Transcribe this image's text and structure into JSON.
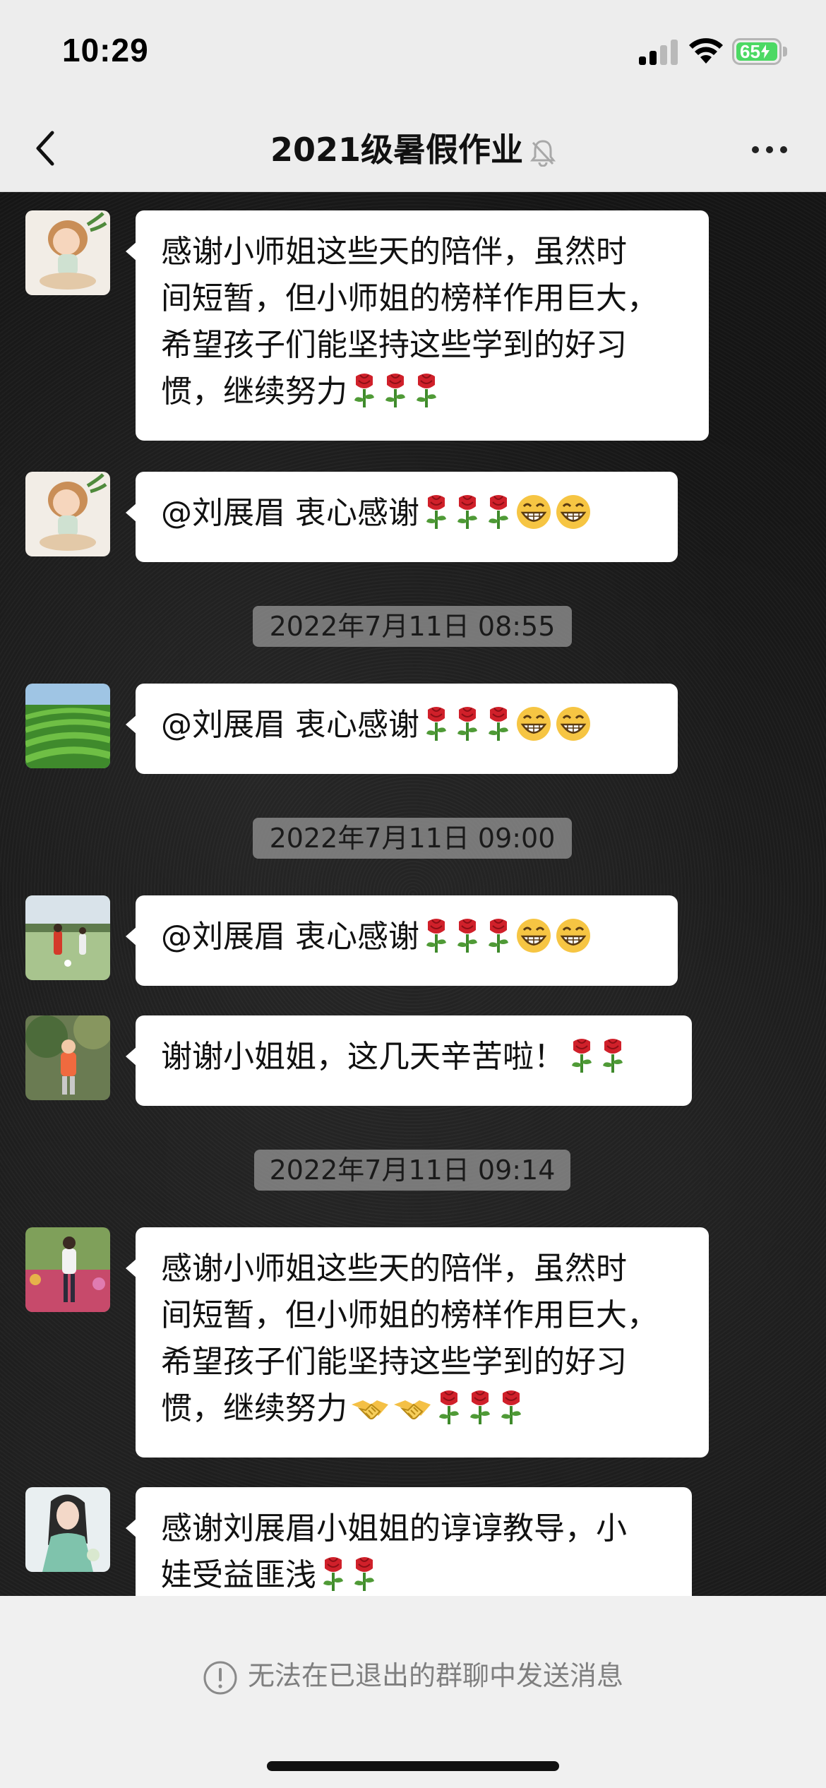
{
  "status_bar": {
    "time": "10:29",
    "battery_level": "65",
    "signal_bars": 4,
    "signal_bars_active": 2,
    "icons": [
      "signal-icon",
      "wifi-icon",
      "battery-charging-icon"
    ]
  },
  "nav": {
    "title": "2021级暑假作业",
    "muted_icon": "bell-muted-icon",
    "back_icon": "chevron-left-icon",
    "more_icon": "more-dots-icon"
  },
  "messages": [
    {
      "type": "message",
      "avatar": "avatar-meditating-girl",
      "lines": [
        "感谢小师姐这些天的陪伴，虽然时",
        "间短暂，但小师姐的榜样作用巨大，",
        "希望孩子们能坚持这些学到的好习",
        "惯，继续努力"
      ],
      "emoji": [
        "rose",
        "rose",
        "rose"
      ]
    },
    {
      "type": "message",
      "avatar": "avatar-meditating-girl",
      "lines": [
        "@刘展眉 衷心感谢"
      ],
      "emoji": [
        "rose",
        "rose",
        "rose",
        "grin",
        "grin"
      ]
    },
    {
      "type": "time",
      "text": "2022年7月11日 08:55"
    },
    {
      "type": "message",
      "avatar": "avatar-tea-field",
      "lines": [
        "@刘展眉 衷心感谢"
      ],
      "emoji": [
        "rose",
        "rose",
        "rose",
        "grin",
        "grin"
      ]
    },
    {
      "type": "time",
      "text": "2022年7月11日 09:00"
    },
    {
      "type": "message",
      "avatar": "avatar-soccer-kids",
      "lines": [
        "@刘展眉 衷心感谢"
      ],
      "emoji": [
        "rose",
        "rose",
        "rose",
        "grin",
        "grin"
      ]
    },
    {
      "type": "message",
      "avatar": "avatar-child-garden",
      "lines": [
        "谢谢小姐姐，这几天辛苦啦！"
      ],
      "emoji": [
        "rose",
        "rose"
      ]
    },
    {
      "type": "time",
      "text": "2022年7月11日 09:14"
    },
    {
      "type": "message",
      "avatar": "avatar-child-flowers",
      "lines": [
        "感谢小师姐这些天的陪伴，虽然时",
        "间短暂，但小师姐的榜样作用巨大，",
        "希望孩子们能坚持这些学到的好习",
        "惯，继续努力"
      ],
      "emoji": [
        "handshake",
        "handshake",
        "rose",
        "rose",
        "rose"
      ]
    },
    {
      "type": "message",
      "avatar": "avatar-illustrated-girl",
      "lines": [
        "感谢刘展眉小姐姐的谆谆教导，小",
        "娃受益匪浅"
      ],
      "emoji": [
        "rose",
        "rose"
      ]
    }
  ],
  "footer": {
    "notice": "无法在已退出的群聊中发送消息",
    "notice_icon": "exclamation-circle-icon"
  },
  "colors": {
    "bubble": "#ffffff",
    "nav_background": "#ededed",
    "chat_background": "#161616",
    "battery": "#4cd964"
  }
}
